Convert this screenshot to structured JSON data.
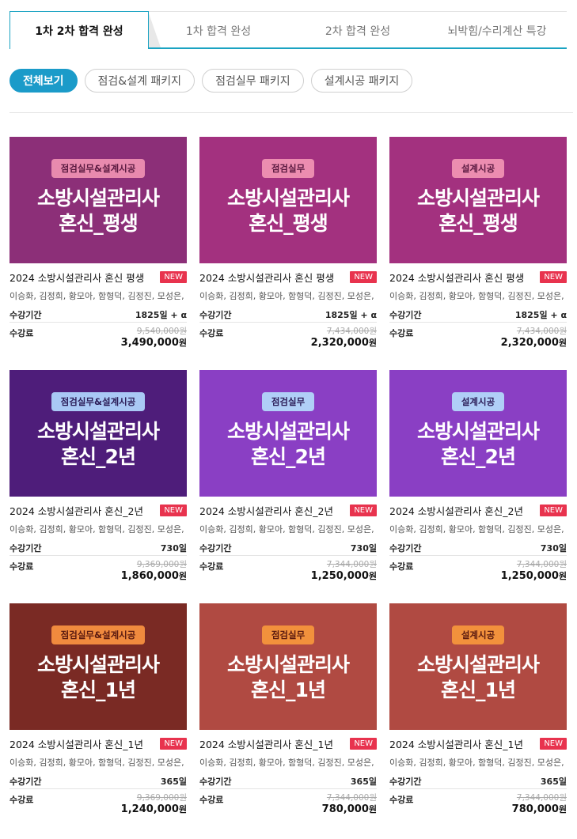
{
  "tabs": [
    {
      "label": "1차 2차 합격 완성",
      "active": true
    },
    {
      "label": "1차 합격 완성",
      "active": false
    },
    {
      "label": "2차 합격 완성",
      "active": false
    },
    {
      "label": "뇌박힘/수리계산 특강",
      "active": false
    }
  ],
  "filters": [
    {
      "label": "전체보기",
      "active": true
    },
    {
      "label": "점검&설계 패키지",
      "active": false
    },
    {
      "label": "점검실무 패키지",
      "active": false
    },
    {
      "label": "설계시공 패키지",
      "active": false
    }
  ],
  "labels": {
    "period": "수강기간",
    "fee": "수강료",
    "new": "NEW",
    "won": "원"
  },
  "courses": [
    {
      "thumb_badge": "점검실무&설계시공",
      "thumb_title": "소방시설관리사",
      "thumb_sub": "혼신_평생",
      "title": "2024 소방시설관리사 혼신 평생",
      "teachers": "이승화, 김정희, 황모아, 함형덕, 김정진, 모성은,",
      "period": "1825일 + α",
      "original_price": "9,540,000원",
      "price": "3,490,000",
      "bg": "#8c2f78",
      "badge_bg": "#e88aae",
      "badge_color": "#5a1940"
    },
    {
      "thumb_badge": "점검실무",
      "thumb_title": "소방시설관리사",
      "thumb_sub": "혼신_평생",
      "title": "2024 소방시설관리사 혼신 평생",
      "teachers": "이승화, 김정희, 황모아, 함형덕, 김정진, 모성은,",
      "period": "1825일 + α",
      "original_price": "7,434,000원",
      "price": "2,320,000",
      "bg": "#a3317f",
      "badge_bg": "#ec8db0",
      "badge_color": "#5a1940"
    },
    {
      "thumb_badge": "설계시공",
      "thumb_title": "소방시설관리사",
      "thumb_sub": "혼신_평생",
      "title": "2024 소방시설관리사 혼신 평생",
      "teachers": "이승화, 김정희, 황모아, 함형덕, 김정진, 모성은,",
      "period": "1825일 + α",
      "original_price": "7,434,000원",
      "price": "2,320,000",
      "bg": "#a3317f",
      "badge_bg": "#ec8db0",
      "badge_color": "#5a1940"
    },
    {
      "thumb_badge": "점검실무&설계시공",
      "thumb_title": "소방시설관리사",
      "thumb_sub": "혼신_2년",
      "title": "2024 소방시설관리사 혼신_2년",
      "teachers": "이승화, 김정희, 황모아, 함형덕, 김정진, 모성은,",
      "period": "730일",
      "original_price": "9,369,000원",
      "price": "1,860,000",
      "bg": "#4e1d7a",
      "badge_bg": "#a9c8f5",
      "badge_color": "#2b1c57"
    },
    {
      "thumb_badge": "점검실무",
      "thumb_title": "소방시설관리사",
      "thumb_sub": "혼신_2년",
      "title": "2024 소방시설관리사 혼신_2년",
      "teachers": "이승화, 김정희, 황모아, 함형덕, 김정진, 모성은,",
      "period": "730일",
      "original_price": "7,344,000원",
      "price": "1,250,000",
      "bg": "#8a3fc4",
      "badge_bg": "#b0cff7",
      "badge_color": "#2b1c57"
    },
    {
      "thumb_badge": "설계시공",
      "thumb_title": "소방시설관리사",
      "thumb_sub": "혼신_2년",
      "title": "2024 소방시설관리사 혼신_2년",
      "teachers": "이승화, 김정희, 황모아, 함형덕, 김정진, 모성은,",
      "period": "730일",
      "original_price": "7,344,000원",
      "price": "1,250,000",
      "bg": "#8a3fc4",
      "badge_bg": "#b0cff7",
      "badge_color": "#2b1c57"
    },
    {
      "thumb_badge": "점검실무&설계시공",
      "thumb_title": "소방시설관리사",
      "thumb_sub": "혼신_1년",
      "title": "2024 소방시설관리사 혼신_1년",
      "teachers": "이승화, 김정희, 황모아, 함형덕, 김정진, 모성은,",
      "period": "365일",
      "original_price": "9,369,000원",
      "price": "1,240,000",
      "bg": "#7a2a24",
      "badge_bg": "#f08a3e",
      "badge_color": "#5a1a10"
    },
    {
      "thumb_badge": "점검실무",
      "thumb_title": "소방시설관리사",
      "thumb_sub": "혼신_1년",
      "title": "2024 소방시설관리사 혼신_1년",
      "teachers": "이승화, 김정희, 황모아, 함형덕, 김정진, 모성은,",
      "period": "365일",
      "original_price": "7,344,000원",
      "price": "780,000",
      "bg": "#b04a42",
      "badge_bg": "#f2913c",
      "badge_color": "#5a1a10"
    },
    {
      "thumb_badge": "설계시공",
      "thumb_title": "소방시설관리사",
      "thumb_sub": "혼신_1년",
      "title": "2024 소방시설관리사 혼신_1년",
      "teachers": "이승화, 김정희, 황모아, 함형덕, 김정진, 모성은,",
      "period": "365일",
      "original_price": "7,344,000원",
      "price": "780,000",
      "bg": "#b04a42",
      "badge_bg": "#f2913c",
      "badge_color": "#5a1a10"
    }
  ]
}
